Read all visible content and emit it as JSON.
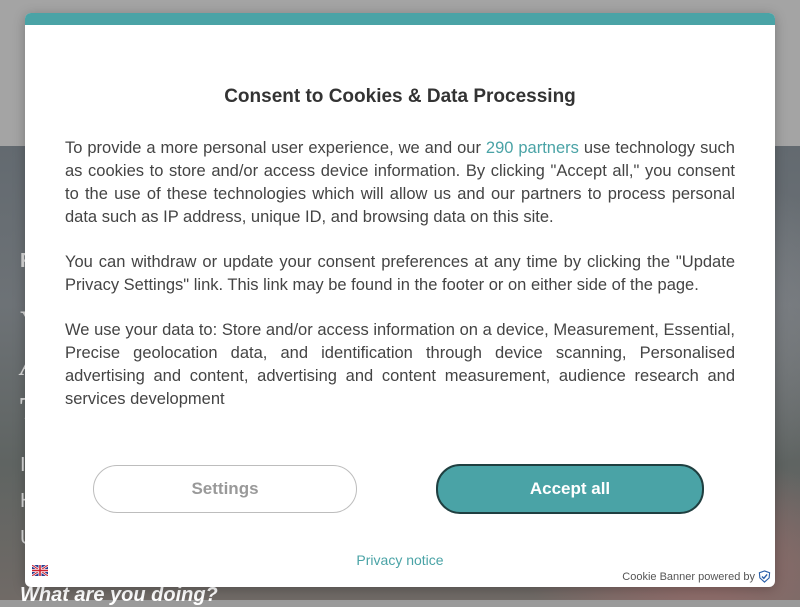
{
  "background": {
    "hero_fragments": [
      "F",
      "Y",
      "A",
      "T",
      "I",
      "H",
      "U"
    ],
    "bottom_text": "What are you doing?"
  },
  "dialog": {
    "title": "Consent to Cookies & Data Processing",
    "para1_before": "To provide a more personal user experience, we and our ",
    "para1_link": "290 partners",
    "para1_after": " use technology such as cookies to store and/or access device information. By clicking \"Accept all,\" you consent to the use of these technologies which will allow us and our partners to process personal data such as IP address, unique ID, and browsing data on this site.",
    "para2": "You can withdraw or update your consent preferences at any time by clicking the \"Update Privacy Settings\" link. This link may be found in the footer or on either side of the page.",
    "para3": "We use your data to: Store and/or access information on a device, Measurement, Essential, Precise geolocation data, and identification through device scanning, Personalised advertising and content, advertising and content measurement, audience research and services development",
    "settings_label": "Settings",
    "accept_label": "Accept all",
    "privacy_label": "Privacy notice",
    "credit_label": "Cookie Banner powered by",
    "language_icon": "uk-flag-icon",
    "accent_color": "#4aa3a6"
  }
}
